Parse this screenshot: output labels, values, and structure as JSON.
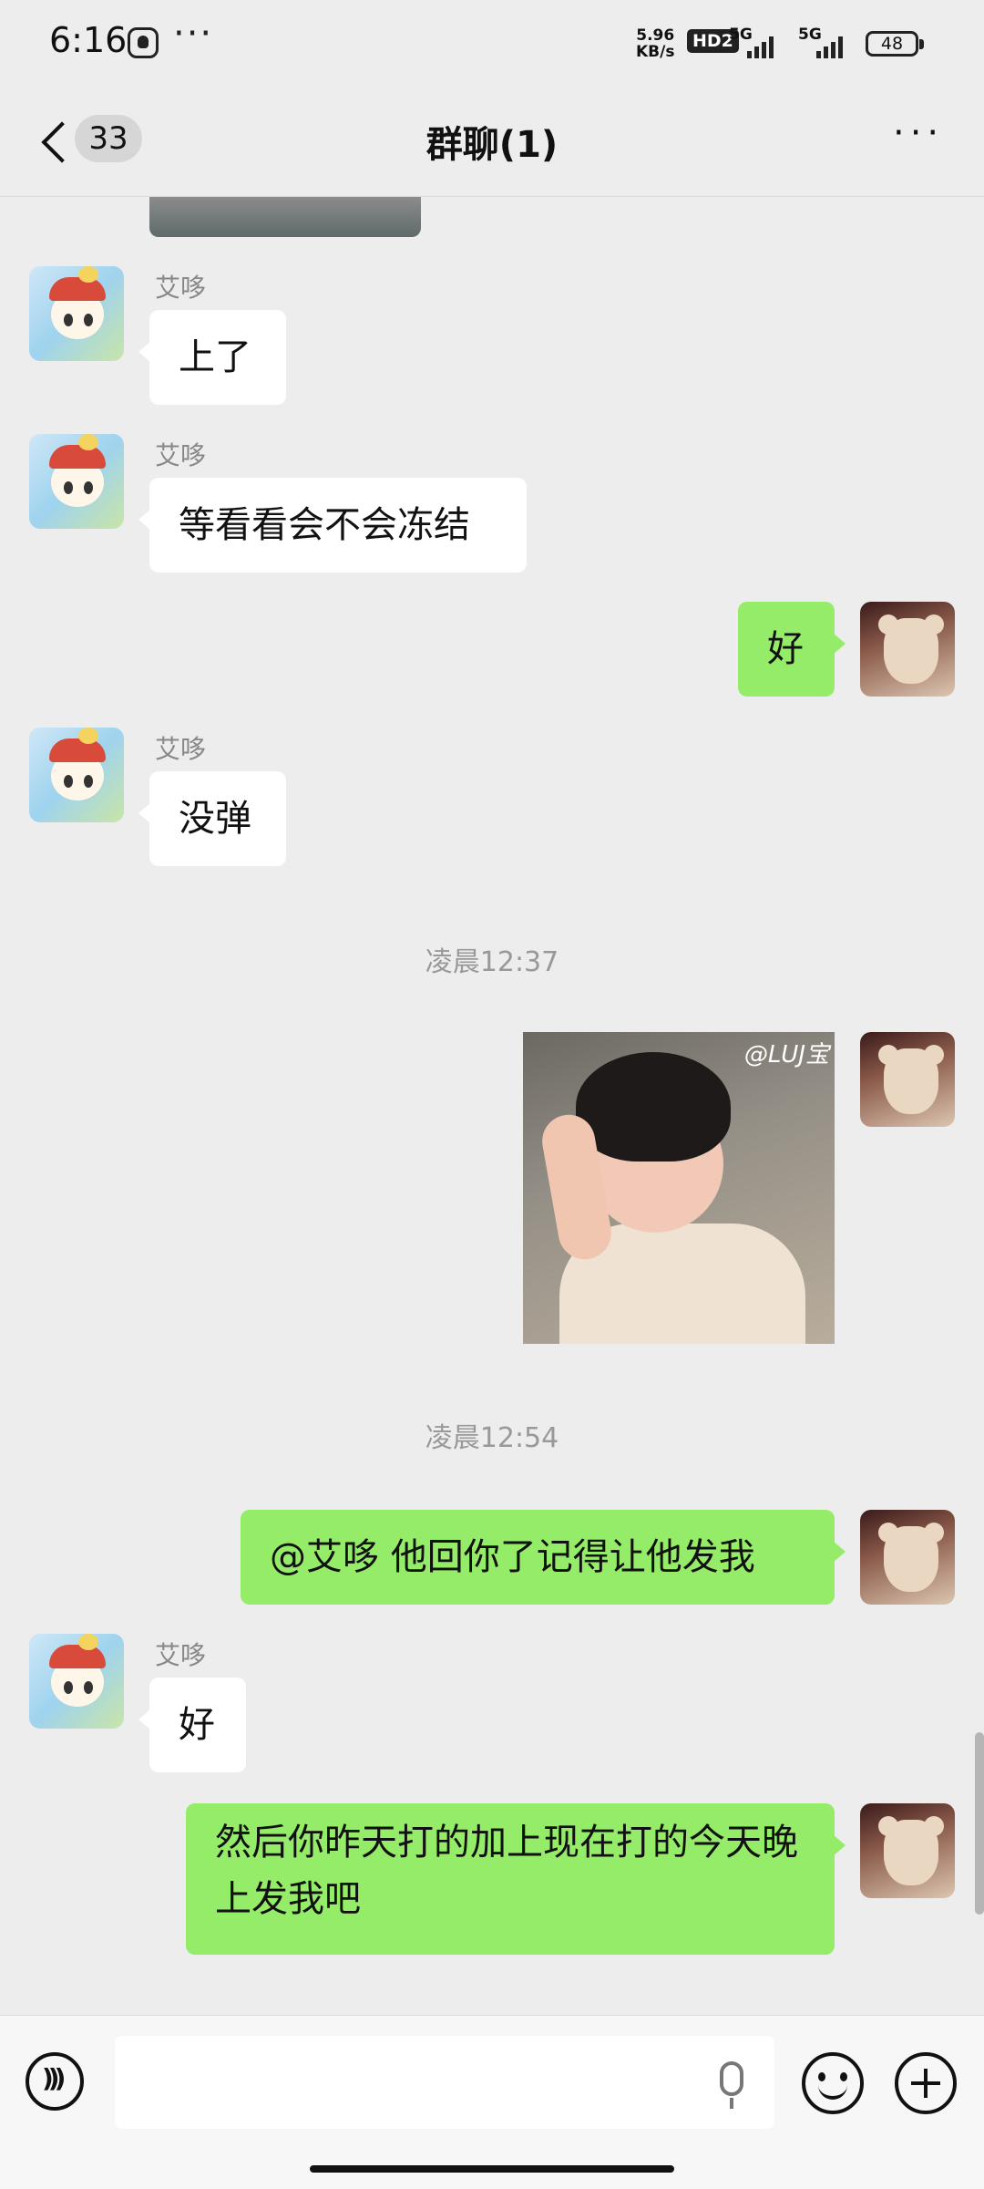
{
  "status": {
    "time": "6:16",
    "dots": "···",
    "net_speed_value": "5.96",
    "net_speed_unit": "KB/s",
    "hd": "HD2",
    "sim1": "5G",
    "sim2": "5G",
    "battery": "48"
  },
  "header": {
    "unread_count": "33",
    "title": "群聊(1)",
    "more": "···"
  },
  "messages": {
    "m1": {
      "sender": "艾哆",
      "text": "上了"
    },
    "m2": {
      "sender": "艾哆",
      "text": "等看看会不会冻结"
    },
    "m3": {
      "text": "好"
    },
    "m4": {
      "sender": "艾哆",
      "text": "没弹"
    },
    "ts1": "凌晨12:37",
    "image_watermark": "@LUJ宝",
    "ts2": "凌晨12:54",
    "m6": {
      "text": "@艾哆  他回你了记得让他发我"
    },
    "m7": {
      "sender": "艾哆",
      "text": "好"
    },
    "m8": {
      "text": "然后你昨天打的加上现在打的今天晚上发我吧"
    }
  },
  "input": {
    "value": "",
    "placeholder": ""
  },
  "icons": {
    "back": "chevron-left-icon",
    "voice": "voice-icon",
    "mic": "microphone-icon",
    "emoji": "emoji-icon",
    "plus": "plus-icon"
  },
  "colors": {
    "background": "#ededed",
    "outgoing_bubble": "#95ec69",
    "incoming_bubble": "#ffffff"
  }
}
